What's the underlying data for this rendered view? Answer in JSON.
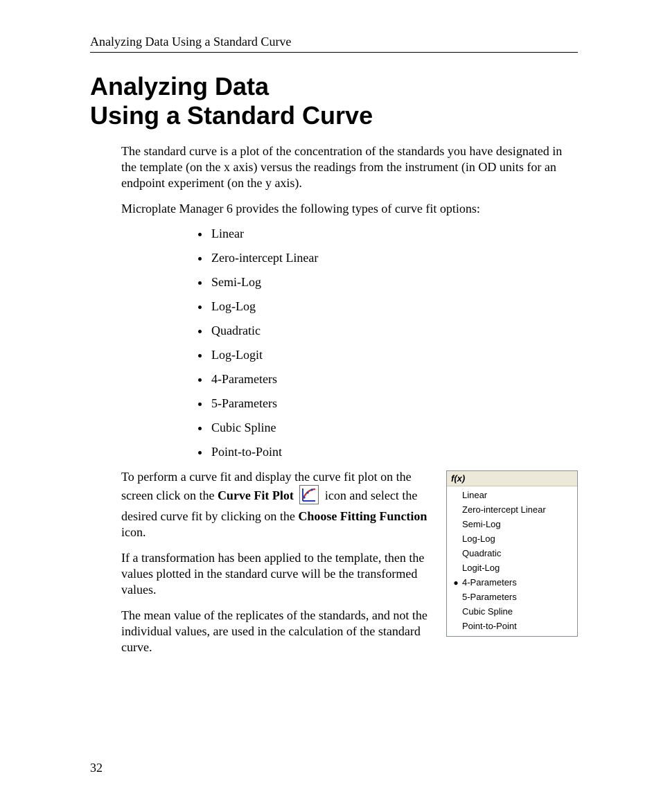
{
  "header": {
    "running_head": "Analyzing Data Using a Standard Curve"
  },
  "title_lines": {
    "l1": "Analyzing Data",
    "l2": "Using a Standard Curve"
  },
  "paragraphs": {
    "intro": "The standard curve is a plot of the concentration of the standards you have designated in the template (on the x axis) versus the readings from the instrument (in OD units for an endpoint experiment (on the y axis).",
    "provides": "Microplate Manager 6 provides the following types of curve fit options:",
    "perform_1a": "To perform a curve fit and display the curve fit plot on the screen click on the ",
    "perform_1b_bold": "Curve Fit Plot",
    "perform_1c": " icon and select the desired curve fit by clicking on the ",
    "perform_1d_bold": "Choose Fitting Function",
    "perform_1e": " icon.",
    "transform": "If a transformation has been applied to the template, then the values plotted in the standard curve will be the transformed values.",
    "mean": "The mean value of the replicates of the standards, and not the individual values, are used in the calculation of the standard curve."
  },
  "fit_list": [
    "Linear",
    "Zero-intercept Linear",
    "Semi-Log",
    "Log-Log",
    "Quadratic",
    "Log-Logit",
    "4-Parameters",
    "5-Parameters",
    "Cubic Spline",
    "Point-to-Point"
  ],
  "menu": {
    "title": "f(x)",
    "items": [
      {
        "label": "Linear",
        "selected": false
      },
      {
        "label": "Zero-intercept Linear",
        "selected": false
      },
      {
        "label": "Semi-Log",
        "selected": false
      },
      {
        "label": "Log-Log",
        "selected": false
      },
      {
        "label": "Quadratic",
        "selected": false
      },
      {
        "label": "Logit-Log",
        "selected": false
      },
      {
        "label": "4-Parameters",
        "selected": true
      },
      {
        "label": "5-Parameters",
        "selected": false
      },
      {
        "label": "Cubic Spline",
        "selected": false
      },
      {
        "label": "Point-to-Point",
        "selected": false
      }
    ]
  },
  "page_number": "32"
}
